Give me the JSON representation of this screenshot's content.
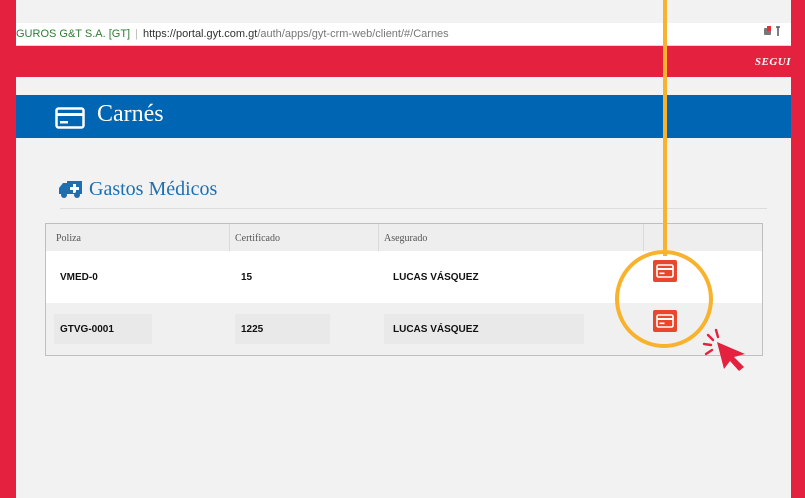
{
  "browser": {
    "site_label": "GUROS G&T S.A. [GT]",
    "url_proto": "https://",
    "url_domain": "portal.gyt.com.gt",
    "url_path": "/auth/apps/gyt-crm-web/client/#/Carnes"
  },
  "header": {
    "brand": "SEGUI"
  },
  "page": {
    "title": "Carnés",
    "title_icon": "credit-card-icon"
  },
  "section": {
    "title": "Gastos Médicos",
    "icon": "ambulance-icon"
  },
  "table": {
    "headers": [
      "Poliza",
      "Certificado",
      "Asegurado"
    ],
    "rows": [
      {
        "poliza": "VMED-0",
        "certificado": "15",
        "asegurado": "LUCAS VÁSQUEZ",
        "action_icon": "card-icon"
      },
      {
        "poliza": "GTVG-0001",
        "certificado": "1225",
        "asegurado": "LUCAS VÁSQUEZ",
        "action_icon": "card-icon"
      }
    ]
  },
  "colors": {
    "brand_red": "#e4213f",
    "title_blue": "#0065b3",
    "action_orange": "#e8462d",
    "highlight_yellow": "#f8b22c"
  }
}
